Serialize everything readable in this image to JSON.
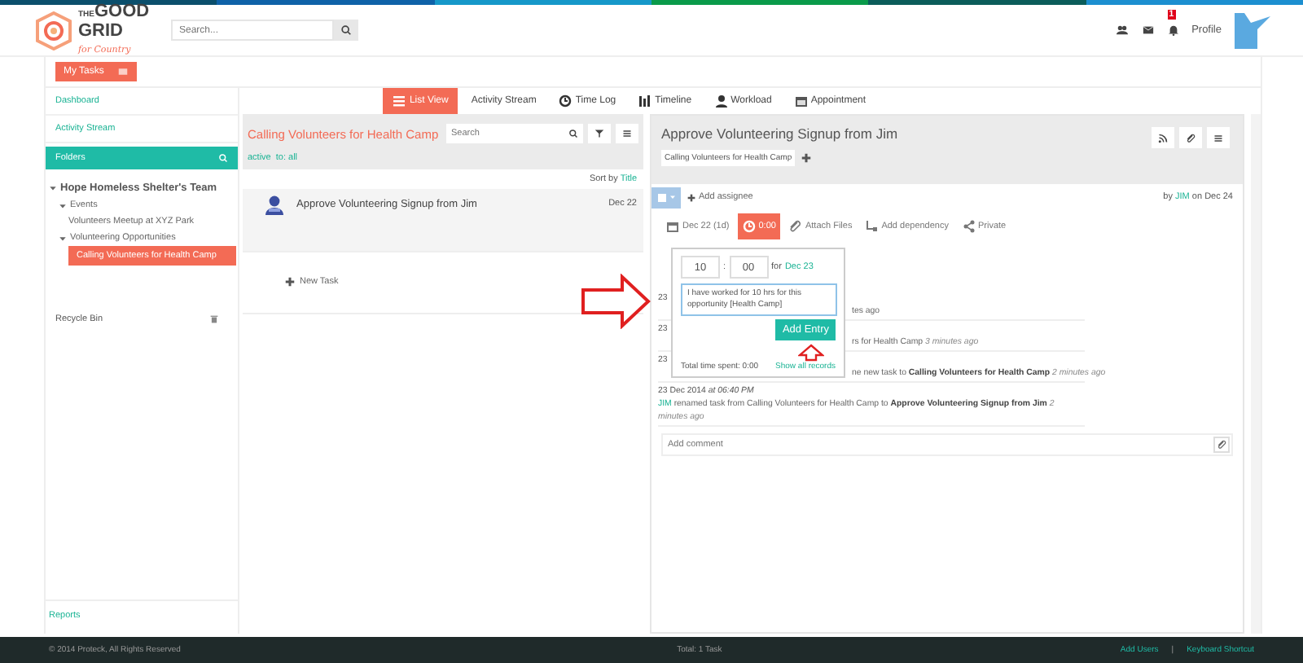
{
  "logo": {
    "word_the": "THE",
    "word_good": "GOOD",
    "word_grid": "GRID",
    "tagline": "for Country"
  },
  "search": {
    "placeholder": "Search..."
  },
  "header": {
    "notification_count": "1",
    "profile": "Profile"
  },
  "my_tasks": "My Tasks",
  "sidebar": {
    "links": [
      "Dashboard",
      "Activity Stream"
    ],
    "folders_title": "Folders",
    "tree": [
      {
        "label": "Hope Homeless Shelter's Team",
        "expanded": true,
        "selected": false,
        "children": [
          {
            "label": "Events",
            "expanded": true,
            "selected": false,
            "children": [
              {
                "label": "Volunteers Meetup at XYZ Park",
                "selected": false
              }
            ]
          },
          {
            "label": "Volunteering Opportunities",
            "expanded": true,
            "selected": false,
            "children": [
              {
                "label": "Calling Volunteers for Health Camp",
                "selected": true
              }
            ]
          }
        ]
      }
    ],
    "recycle_bin": "Recycle Bin",
    "reports": "Reports"
  },
  "view_tabs": [
    {
      "kind": "list",
      "label": "List View",
      "selected": true
    },
    {
      "kind": "stream",
      "label": "Activity Stream",
      "selected": false
    },
    {
      "kind": "clock",
      "label": "Time Log",
      "selected": false
    },
    {
      "kind": "timeline",
      "label": "Timeline",
      "selected": false
    },
    {
      "kind": "person",
      "label": "Workload",
      "selected": false
    },
    {
      "kind": "calendar",
      "label": "Appointment",
      "selected": false
    }
  ],
  "list": {
    "title": "Calling Volunteers for Health Camp",
    "search_placeholder": "Search",
    "filters": [
      "active",
      "to: all"
    ],
    "sort_label": "Sort by",
    "sort_field": "Title",
    "tasks": [
      {
        "title": "Approve Volunteering Signup from Jim",
        "date": "Dec 22"
      }
    ],
    "new_task": "New Task"
  },
  "task": {
    "title": "Approve Volunteering Signup from Jim",
    "folder_tag": "Calling Volunteers for Health Camp",
    "add_assignee": "Add assignee",
    "by": "by",
    "author": "JIM",
    "on": "on Dec 24",
    "toolbar": [
      {
        "kind": "date",
        "label": "Dec 22 (1d)",
        "active": false
      },
      {
        "kind": "timer",
        "label": "0:00",
        "active": true
      },
      {
        "kind": "attach",
        "label": "Attach Files",
        "active": false
      },
      {
        "kind": "dependency",
        "label": "Add dependency",
        "active": false
      },
      {
        "kind": "private",
        "label": "Private",
        "active": false
      }
    ],
    "activity": [
      {
        "date": "23",
        "text": "tes ago"
      },
      {
        "date": "23",
        "text": "rs for Health Camp",
        "suffix": "3 minutes ago"
      },
      {
        "date": "23",
        "text": "ne new task to **Calling Volunteers for Health Camp**",
        "suffix": "2 minutes ago"
      },
      {
        "date": "23 Dec 2014 *at 06:40 PM*",
        "author": "JIM",
        "text": "renamed task from Calling Volunteers for Health Camp to **Approve Volunteering Signup from Jim**",
        "suffix": "2 minutes ago"
      }
    ],
    "comment_placeholder": "Add comment"
  },
  "time_popup": {
    "hours": "10",
    "separator": ":",
    "minutes": "00",
    "for": "for",
    "date": "Dec 23",
    "note": "I have worked for 10 hrs for this opportunity [Health Camp]",
    "button": "Add Entry",
    "total": "Total time spent: 0:00",
    "show_all": "Show all records"
  },
  "footer": {
    "copyright": "© 2014 Proteck, All Rights Reserved",
    "total": "Total: 1 Task",
    "links": [
      "Add Users",
      "Keyboard Shortcut"
    ],
    "separator": "|"
  }
}
